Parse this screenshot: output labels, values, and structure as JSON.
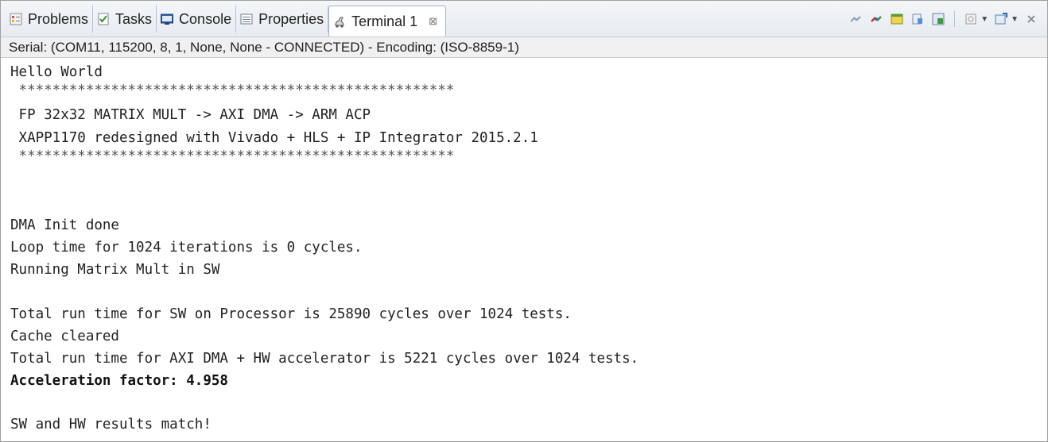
{
  "tabs": [
    {
      "label": "Problems",
      "icon": "problems-icon"
    },
    {
      "label": "Tasks",
      "icon": "tasks-icon"
    },
    {
      "label": "Console",
      "icon": "console-icon"
    },
    {
      "label": "Properties",
      "icon": "properties-icon"
    },
    {
      "label": "Terminal 1",
      "icon": "terminal-icon",
      "active": true,
      "close": "⊠"
    }
  ],
  "status_line": "Serial: (COM11, 115200, 8, 1, None, None - CONNECTED) - Encoding: (ISO-8859-1)",
  "terminal": {
    "lines": [
      "Hello World",
      " ****************************************************",
      " FP 32x32 MATRIX MULT -> AXI DMA -> ARM ACP",
      " XAPP1170 redesigned with Vivado + HLS + IP Integrator 2015.2.1",
      " ****************************************************",
      "",
      "",
      "DMA Init done",
      "Loop time for 1024 iterations is 0 cycles.",
      "Running Matrix Mult in SW",
      "",
      "Total run time for SW on Processor is 25890 cycles over 1024 tests.",
      "Cache cleared",
      "Total run time for AXI DMA + HW accelerator is 5221 cycles over 1024 tests.",
      "Acceleration factor: 4.958",
      "",
      "SW and HW results match!"
    ]
  }
}
